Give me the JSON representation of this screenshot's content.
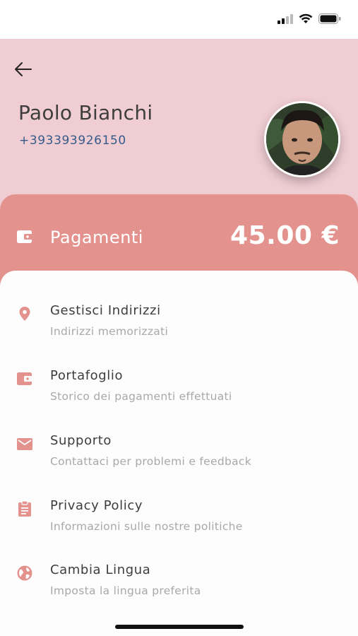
{
  "user": {
    "name": "Paolo Bianchi",
    "phone": "+393393926150"
  },
  "payments": {
    "label": "Pagamenti",
    "amount": "45.00 €"
  },
  "menu": [
    {
      "icon": "location-pin-icon",
      "title": "Gestisci Indirizzi",
      "subtitle": "Indirizzi memorizzati"
    },
    {
      "icon": "wallet-icon",
      "title": "Portafoglio",
      "subtitle": "Storico dei pagamenti effettuati"
    },
    {
      "icon": "mail-icon",
      "title": "Supporto",
      "subtitle": "Contattaci per problemi e feedback"
    },
    {
      "icon": "clipboard-icon",
      "title": "Privacy Policy",
      "subtitle": "Informazioni sulle nostre politiche"
    },
    {
      "icon": "globe-icon",
      "title": "Cambia Lingua",
      "subtitle": "Imposta la lingua preferita"
    }
  ],
  "colors": {
    "header_bg": "#efcdd3",
    "payments_bg": "#e3928d",
    "accent_icon": "#e3928d",
    "phone_text": "#355a8a"
  }
}
